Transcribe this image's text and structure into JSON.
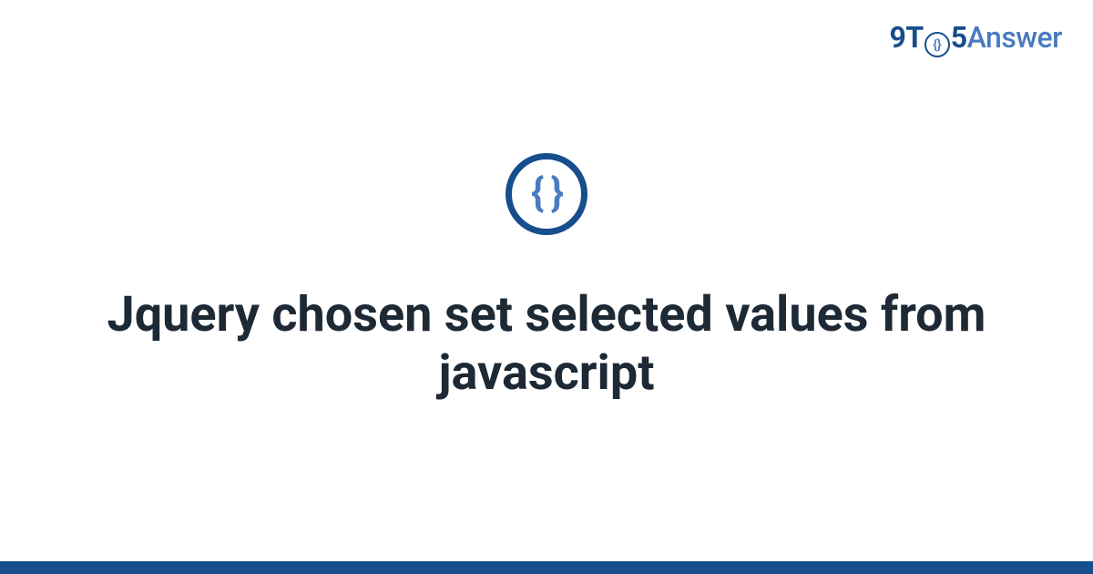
{
  "brand": {
    "nine_t": "9T",
    "o_inner": "{}",
    "five": "5",
    "answer": "Answer"
  },
  "icon": {
    "braces": "{ }"
  },
  "title": "Jquery chosen set selected values from javascript"
}
